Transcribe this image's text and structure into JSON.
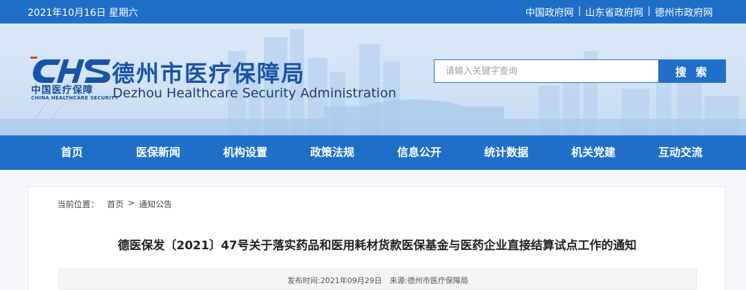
{
  "topbar": {
    "date": "2021年10月16日 星期六",
    "links": [
      "中国政府网",
      "山东省政府网",
      "德州市政府网"
    ],
    "separator": "|"
  },
  "header": {
    "logo_letters": "CHS",
    "logo_cn": "中国医疗保障",
    "logo_en": "CHINA HEALTHCARE SECURITY",
    "title_cn": "德州市医疗保障局",
    "title_en": "Dezhou Healthcare Security Administration",
    "colors": {
      "brand": "#1f6fc9",
      "title": "#1a52a6"
    }
  },
  "search": {
    "placeholder": "请输入关键字查询",
    "button_label": "搜 索"
  },
  "nav": {
    "items": [
      "首页",
      "医保新闻",
      "机构设置",
      "政策法规",
      "信息公开",
      "统计数据",
      "机关党建",
      "互动交流"
    ]
  },
  "breadcrumb": {
    "prefix": "当前位置：",
    "home": "首页",
    "sep": ">",
    "current": "通知公告"
  },
  "article": {
    "title": "德医保发〔2021〕47号关于落实药品和医用耗材货款医保基金与医药企业直接结算试点工作的通知",
    "publish_label": "发布时间:2021年09月29日",
    "source_label": "来源:德州市医疗保障局"
  }
}
